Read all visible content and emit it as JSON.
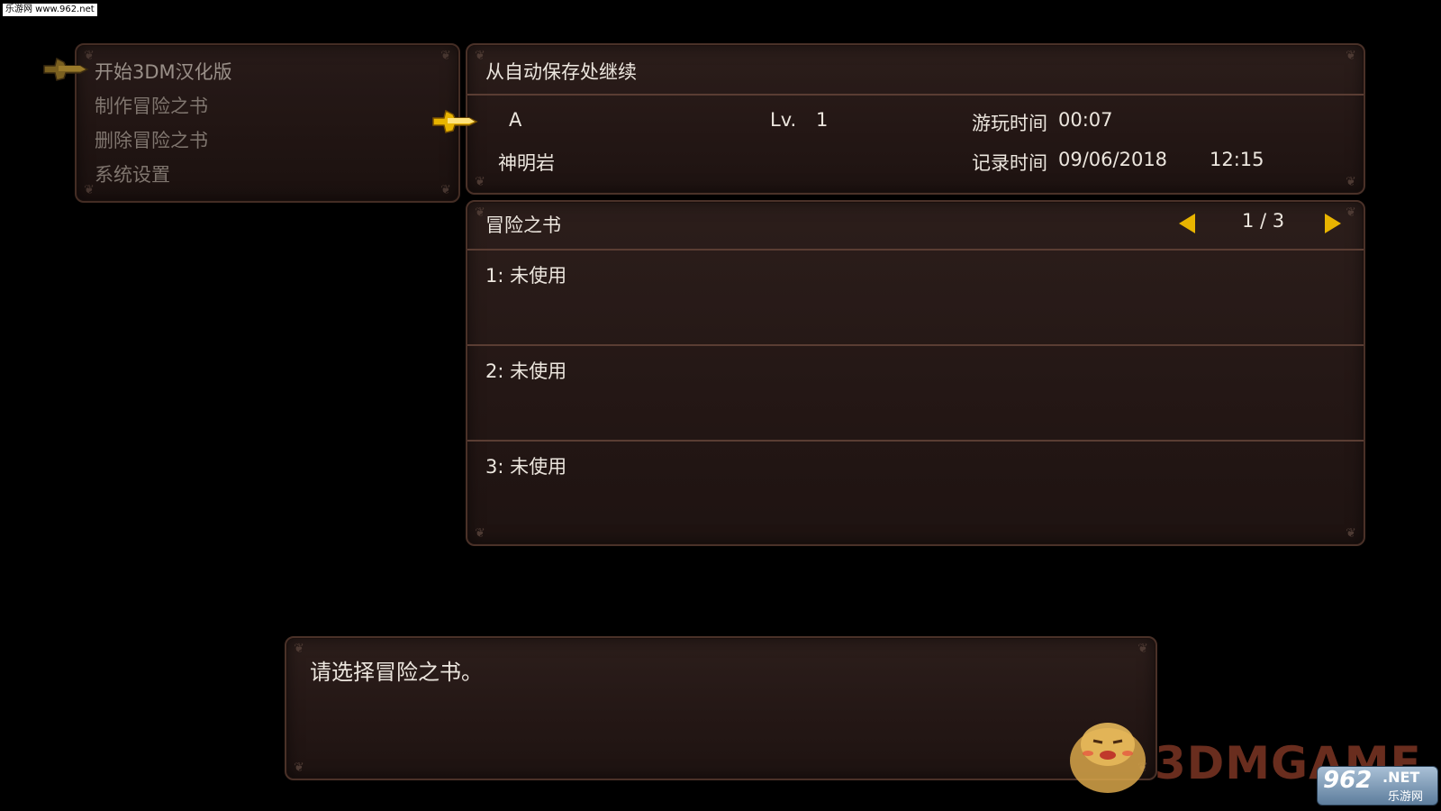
{
  "watermark_top": "乐游网 www.962.net",
  "menu": {
    "items": [
      {
        "label": "开始3DM汉化版"
      },
      {
        "label": "制作冒险之书"
      },
      {
        "label": "删除冒险之书"
      },
      {
        "label": "系统设置"
      }
    ]
  },
  "autosave": {
    "title": "从自动保存处继续",
    "name": "A",
    "level_label": "Lv.",
    "level_value": "1",
    "playtime_label": "游玩时间",
    "playtime_value": "00:07",
    "location": "神明岩",
    "record_label": "记录时间",
    "record_date": "09/06/2018",
    "record_time": "12:15"
  },
  "books": {
    "title": "冒险之书",
    "page": "1 / 3",
    "slots": [
      {
        "label": "1: 未使用"
      },
      {
        "label": "2: 未使用"
      },
      {
        "label": "3: 未使用"
      }
    ]
  },
  "help": {
    "text": "请选择冒险之书。"
  },
  "logos": {
    "brand_3dm": "3DMGAME",
    "brand_962_number": "962",
    "brand_962_net": ".NET",
    "brand_962_cn": "乐游网"
  },
  "icons": {
    "pointer": "hand-pointer-icon",
    "page_prev": "triangle-left-icon",
    "page_next": "triangle-right-icon"
  },
  "colors": {
    "panel_bg": "#2a1c19",
    "panel_border": "#4a3128",
    "pointer_gold": "#e8b400"
  }
}
